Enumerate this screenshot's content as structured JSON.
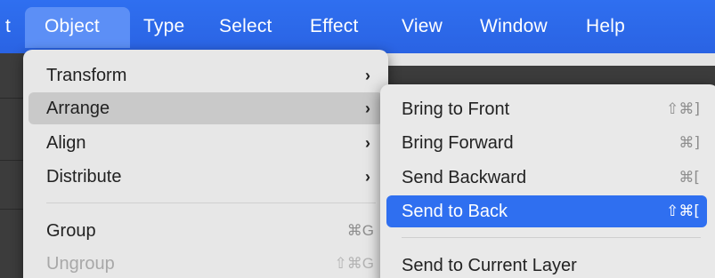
{
  "menubar": {
    "partial_left": "t",
    "items": [
      "Object",
      "Type",
      "Select",
      "Effect",
      "View",
      "Window",
      "Help"
    ],
    "active": "Object"
  },
  "object_menu": {
    "items": [
      {
        "label": "Transform",
        "submenu": true
      },
      {
        "label": "Arrange",
        "submenu": true,
        "highlighted": true
      },
      {
        "label": "Align",
        "submenu": true
      },
      {
        "label": "Distribute",
        "submenu": true
      },
      {
        "label": "Group",
        "shortcut": "⌘G"
      },
      {
        "label": "Ungroup",
        "shortcut": "⇧⌘G",
        "disabled": true
      }
    ],
    "arrow": "›"
  },
  "arrange_menu": {
    "items": [
      {
        "label": "Bring to Front",
        "shortcut": "⇧⌘]"
      },
      {
        "label": "Bring Forward",
        "shortcut": "⌘]"
      },
      {
        "label": "Send Backward",
        "shortcut": "⌘["
      },
      {
        "label": "Send to Back",
        "shortcut": "⇧⌘[",
        "selected": true
      },
      {
        "label": "Send to Current Layer"
      }
    ]
  },
  "colors": {
    "accent": "#2f6ff0",
    "menu_bg": "#e7e7e7",
    "hover": "#c9c9c9"
  }
}
